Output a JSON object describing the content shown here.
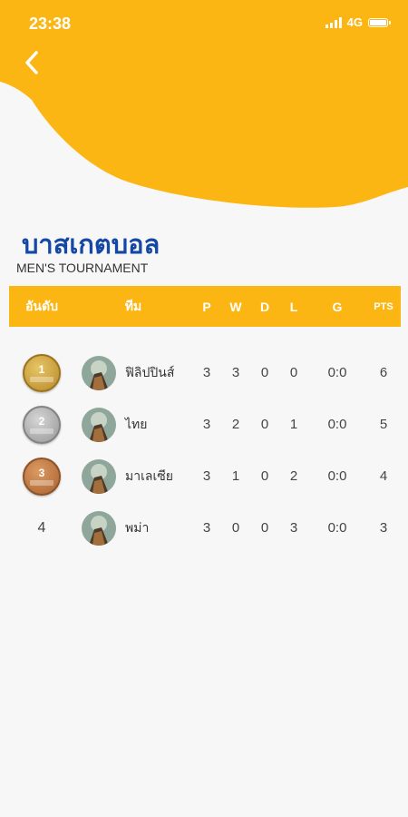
{
  "status": {
    "time": "23:38",
    "network": "4G"
  },
  "colors": {
    "accent": "#fbb614",
    "title": "#1547a5",
    "gold": "#c79a2e",
    "silver": "#a9a9a9",
    "bronze": "#c0763d"
  },
  "header": {
    "title": "บาสเกตบอล",
    "subtitle": "MEN'S TOURNAMENT"
  },
  "table": {
    "headers": {
      "rank": "อันดับ",
      "team": "ทีม",
      "p": "P",
      "w": "W",
      "d": "D",
      "l": "L",
      "g": "G",
      "pts": "PTS"
    },
    "rows": [
      {
        "rank": "1",
        "medal": "gold",
        "team": "ฟิลิปปินส์",
        "p": "3",
        "w": "3",
        "d": "0",
        "l": "0",
        "g": "0:0",
        "pts": "6"
      },
      {
        "rank": "2",
        "medal": "silver",
        "team": "ไทย",
        "p": "3",
        "w": "2",
        "d": "0",
        "l": "1",
        "g": "0:0",
        "pts": "5"
      },
      {
        "rank": "3",
        "medal": "bronze",
        "team": "มาเลเซีย",
        "p": "3",
        "w": "1",
        "d": "0",
        "l": "2",
        "g": "0:0",
        "pts": "4"
      },
      {
        "rank": "4",
        "medal": "",
        "team": "พม่า",
        "p": "3",
        "w": "0",
        "d": "0",
        "l": "3",
        "g": "0:0",
        "pts": "3"
      }
    ]
  }
}
